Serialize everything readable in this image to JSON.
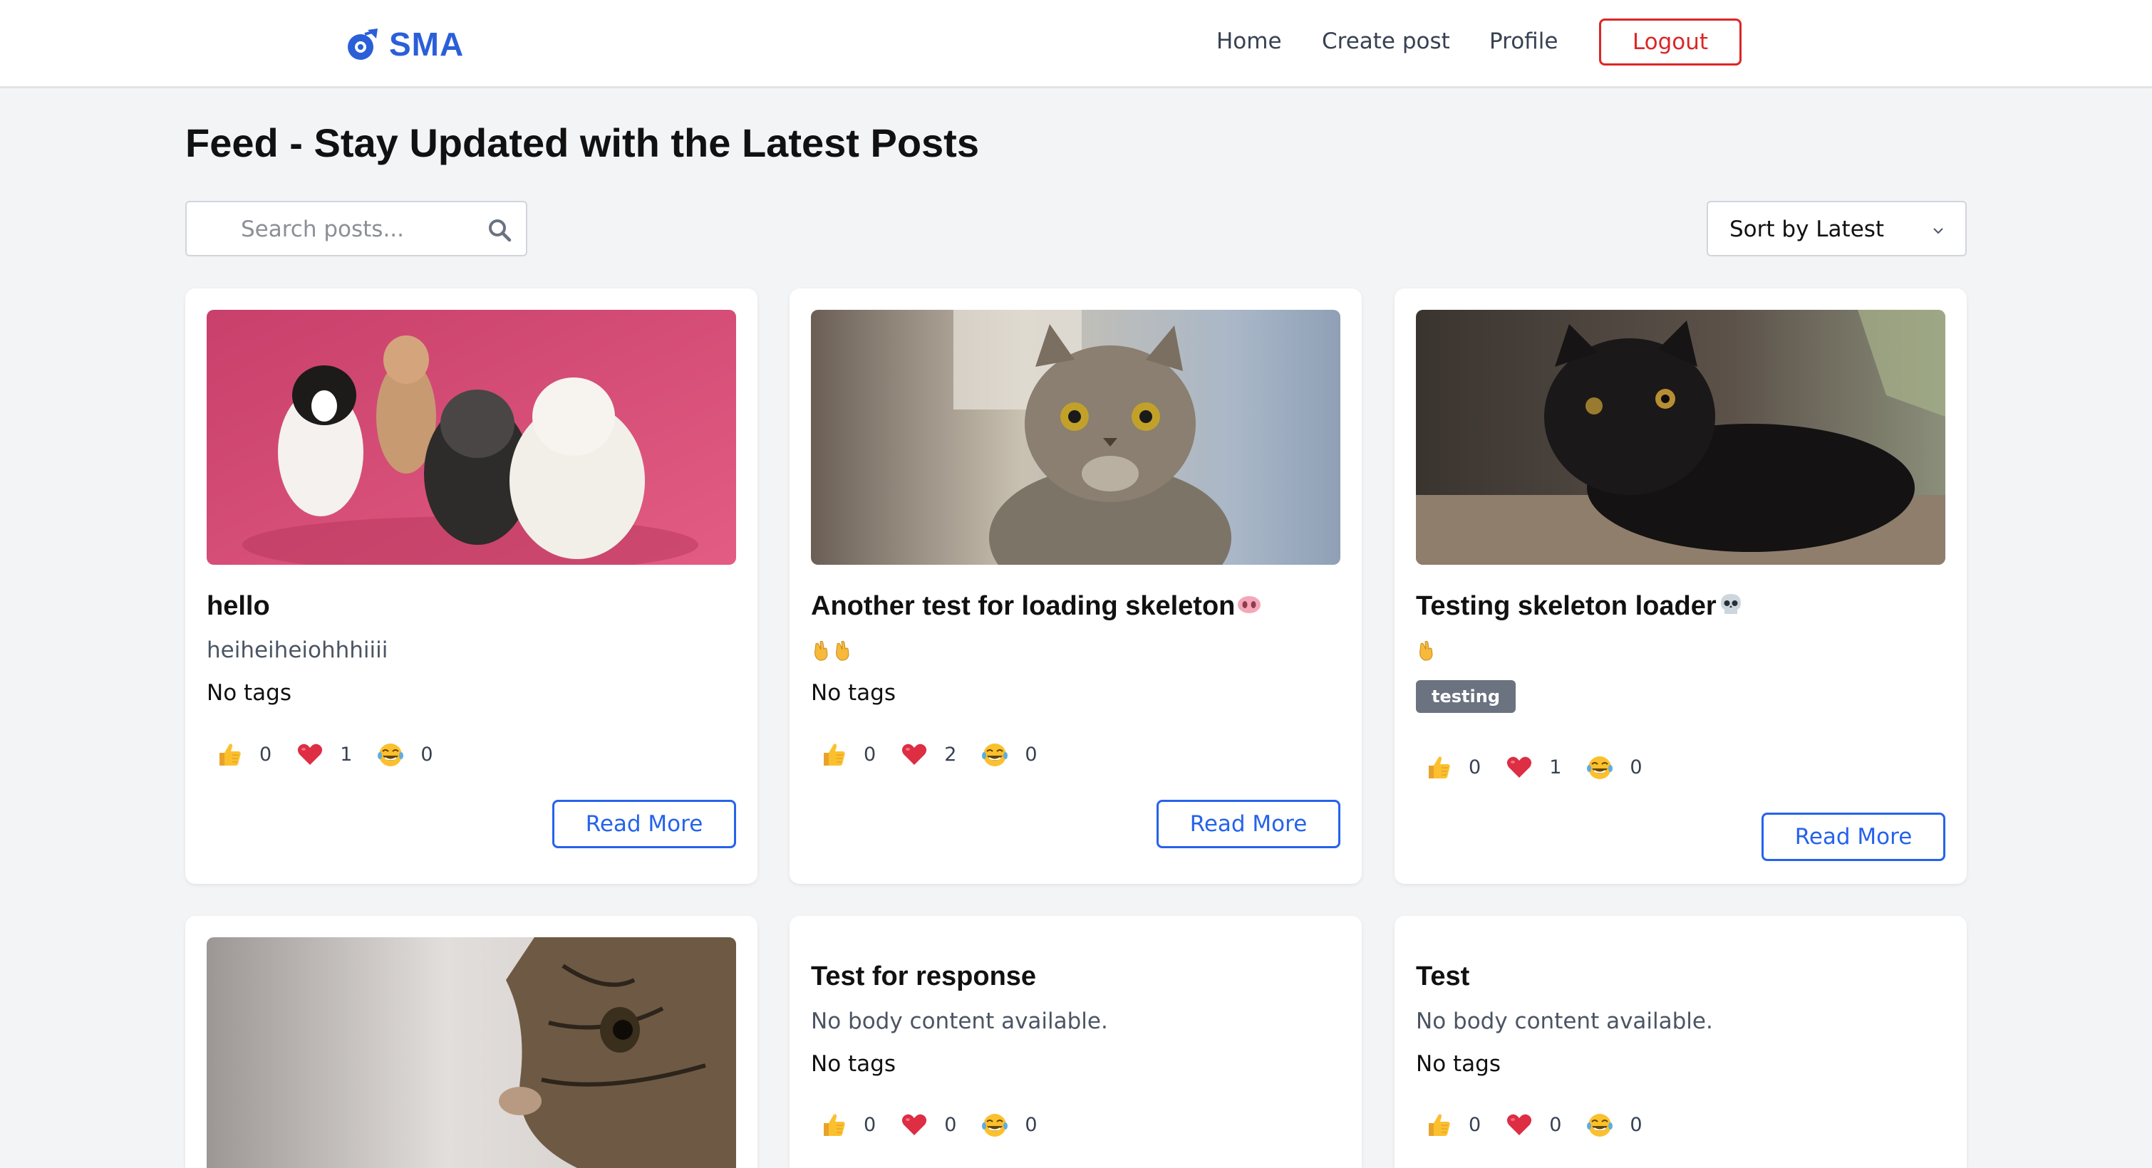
{
  "nav": {
    "brand": "SMA",
    "links": [
      "Home",
      "Create post",
      "Profile"
    ],
    "logout": "Logout"
  },
  "page": {
    "title": "Feed - Stay Updated with the Latest Posts"
  },
  "search": {
    "placeholder": "Search posts..."
  },
  "sort": {
    "selected": "Sort by Latest"
  },
  "colors": {
    "accent": "#2563eb",
    "brand": "#2b5fd9",
    "danger": "#dc2626",
    "tag": "#6b7280"
  },
  "posts": [
    {
      "title": "hello",
      "title_emoji": "",
      "body": "heiheiheiohhhiiii",
      "tags_text": "No tags",
      "tags": [],
      "likes": "0",
      "hearts": "1",
      "laughs": "0",
      "read_more": "Read More",
      "image": "dogs-photo"
    },
    {
      "title": "Another test for loading skeleton",
      "title_emoji": "pig-nose-emoji",
      "body": "",
      "body_emoji": "crossed-fingers x2",
      "tags_text": "No tags",
      "tags": [],
      "likes": "0",
      "hearts": "2",
      "laughs": "0",
      "read_more": "Read More",
      "image": "tabby-cat-photo"
    },
    {
      "title": "Testing skeleton loader",
      "title_emoji": "skull-emoji",
      "body": "",
      "body_emoji": "crossed-fingers",
      "tags_text": "",
      "tags": [
        "testing"
      ],
      "likes": "0",
      "hearts": "1",
      "laughs": "0",
      "read_more": "Read More",
      "image": "black-cat-photo"
    },
    {
      "title": "",
      "body": "",
      "image": "kitten-profile-photo"
    },
    {
      "title": "Test for response",
      "body": "No body content available.",
      "tags_text": "No tags",
      "likes": "0",
      "hearts": "0",
      "laughs": "0"
    },
    {
      "title": "Test",
      "body": "No body content available.",
      "tags_text": "No tags",
      "likes": "0",
      "hearts": "0",
      "laughs": "0"
    }
  ]
}
